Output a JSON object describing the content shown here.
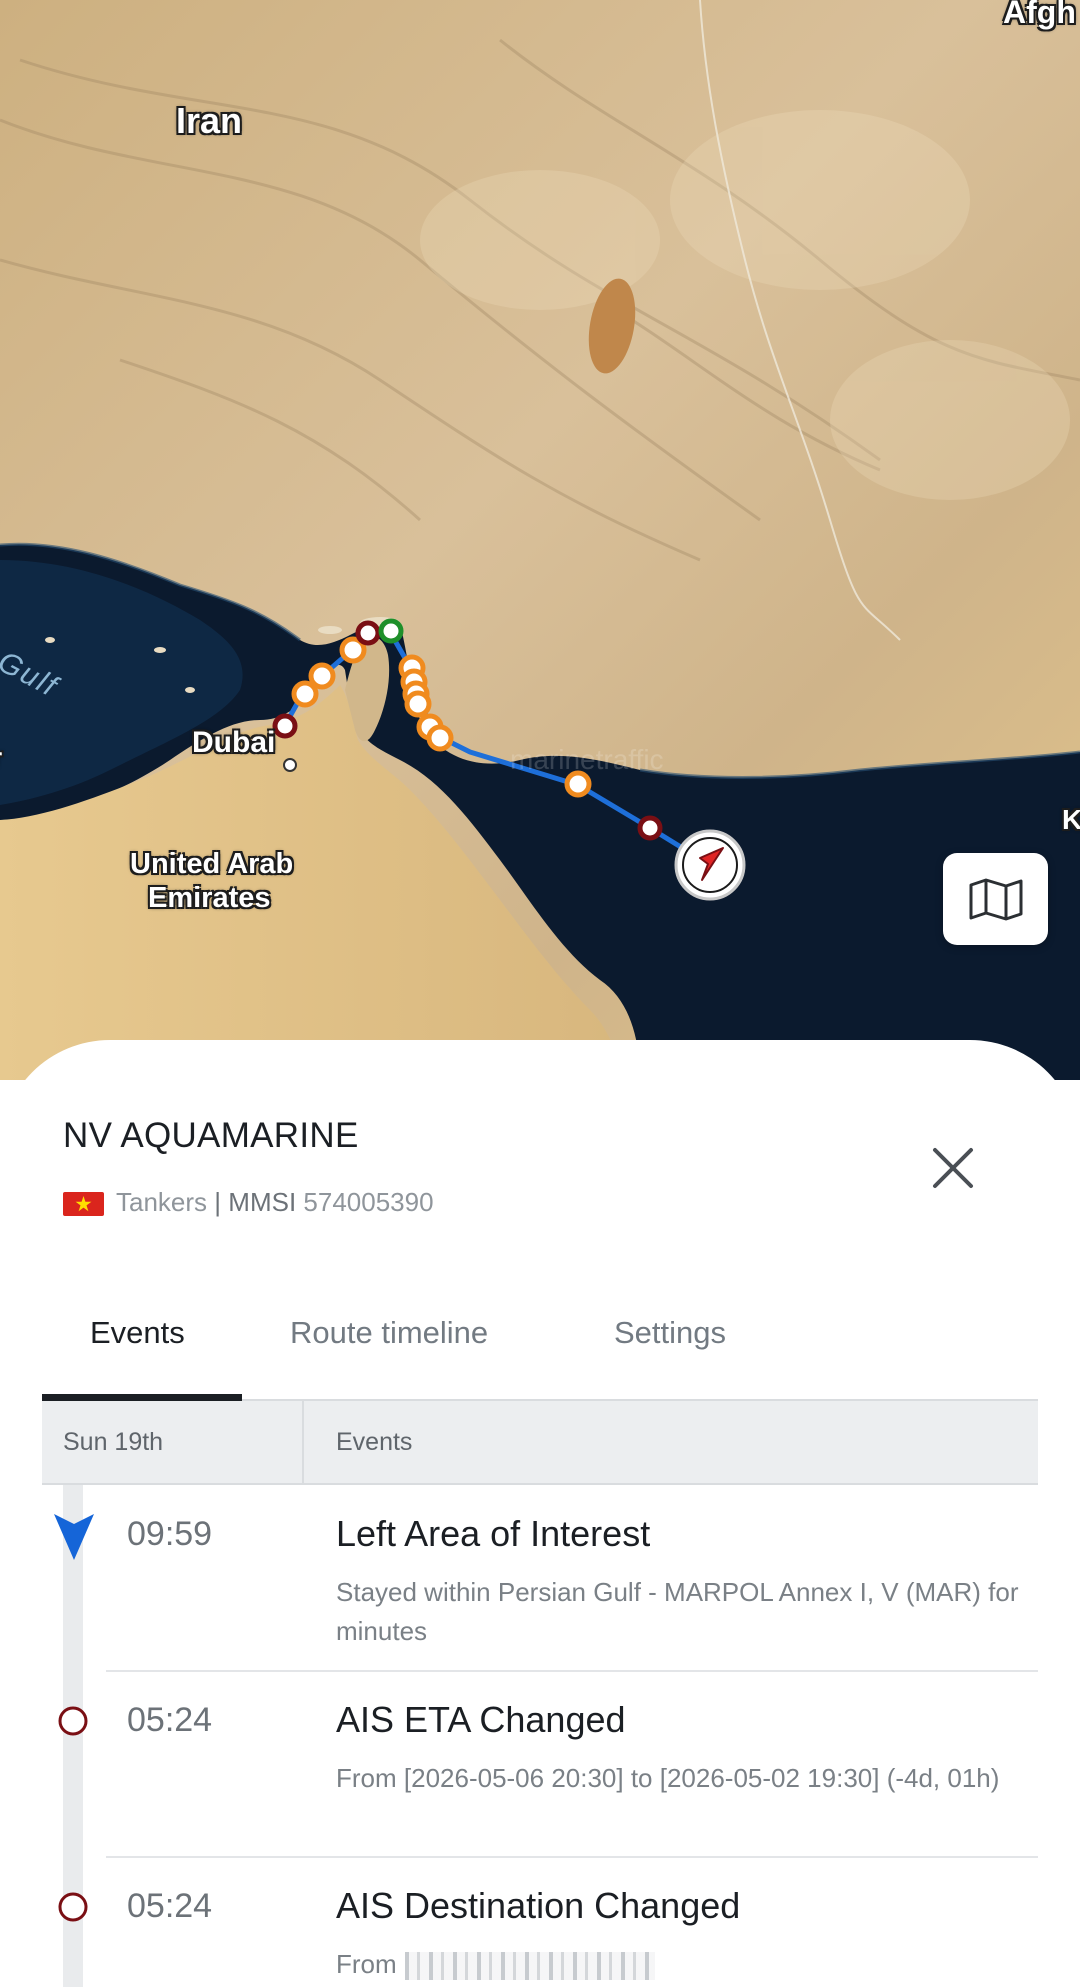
{
  "map": {
    "labels": {
      "iran": "Iran",
      "afghanistan_partial": "Afgh",
      "gulf_partial": "Gulf",
      "dubai": "Dubai",
      "uae_line1": "United Arab",
      "uae_line2": "Emirates",
      "left_edge_partial": "r",
      "right_edge_partial": "K",
      "watermark": "marinetraffic"
    },
    "colors": {
      "land": "#d7b889",
      "water": "#0b1a2e",
      "track": "#1e6fd9",
      "waypoint": "#f08b1f",
      "event_marker": "#7a0f14",
      "start_marker": "#1e8f2a",
      "vessel": "#e02424"
    },
    "toggle_icon": "map-icon"
  },
  "vessel": {
    "name": "NV AQUAMARINE",
    "flag": "vietnam-flag",
    "type": "Tankers",
    "separator": "|",
    "mmsi_label": "MMSI",
    "mmsi": "574005390"
  },
  "tabs": [
    {
      "label": "Events",
      "active": true
    },
    {
      "label": "Route timeline",
      "active": false
    },
    {
      "label": "Settings",
      "active": false
    }
  ],
  "table": {
    "date_header": "Sun 19th",
    "events_header": "Events"
  },
  "events": [
    {
      "time": "09:59",
      "title": "Left Area of Interest",
      "description": "Stayed within Persian Gulf - MARPOL Annex I, V (MAR) for  minutes",
      "marker": "current-triangle"
    },
    {
      "time": "05:24",
      "title": "AIS ETA Changed",
      "description": "From [2026-05-06 20:30] to [2026-05-02 19:30] (-4d, 01h)",
      "marker": "hollow-circle"
    },
    {
      "time": "05:24",
      "title": "AIS Destination Changed",
      "description": "From",
      "marker": "hollow-circle"
    }
  ]
}
